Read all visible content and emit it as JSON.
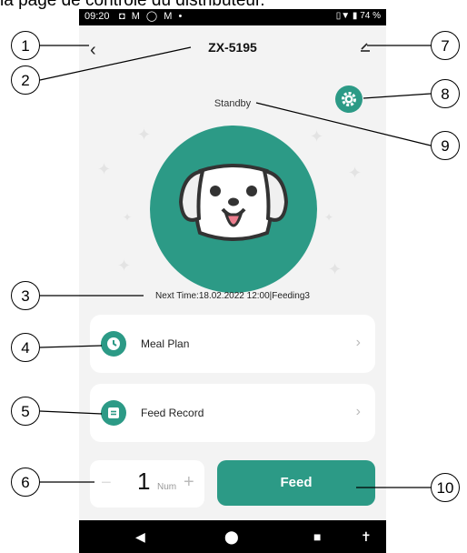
{
  "caption": "la page de contrôle du distributeur.",
  "status_bar": {
    "time": "09:20",
    "icons": "◘ M ◯ M •",
    "right": "▯▼ ▮ 74 %"
  },
  "header": {
    "title": "ZX-5195",
    "back_icon": "chevron-left-icon",
    "edit_icon": "pencil-icon"
  },
  "device": {
    "status": "Standby",
    "next_time": "Next Time:18.02.2022 12:00|Feeding3"
  },
  "menu": [
    {
      "label": "Meal Plan",
      "icon": "clock-icon"
    },
    {
      "label": "Feed Record",
      "icon": "record-icon"
    }
  ],
  "quantity": {
    "minus": "−",
    "value": "1",
    "unit": "Num",
    "plus": "+"
  },
  "feed_button": "Feed",
  "callouts": [
    "1",
    "2",
    "3",
    "4",
    "5",
    "6",
    "7",
    "8",
    "9",
    "10"
  ],
  "colors": {
    "accent": "#2c9a86",
    "background": "#f3f3f3"
  }
}
